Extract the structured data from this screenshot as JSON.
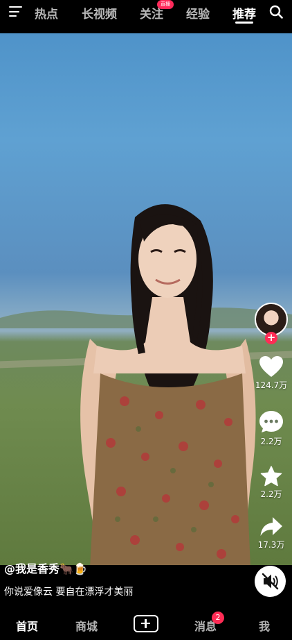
{
  "top_tabs": [
    {
      "label": "热点"
    },
    {
      "label": "长视频"
    },
    {
      "label": "关注"
    },
    {
      "label": "经验"
    },
    {
      "label": "推荐"
    }
  ],
  "live_badge": "直播",
  "video": {
    "author": "@我是香秀",
    "author_emoji": "🐂🍺",
    "caption": "你说爱像云 要自在漂浮才美丽"
  },
  "actions": {
    "likes": "124.7万",
    "comments": "2.2万",
    "favorites": "2.2万",
    "shares": "17.3万"
  },
  "bottom_nav": [
    {
      "label": "首页"
    },
    {
      "label": "商城"
    },
    {
      "label": "消息"
    },
    {
      "label": "我"
    }
  ],
  "message_badge_count": "2",
  "colors": {
    "accent": "#fe2c55",
    "background": "#000000"
  }
}
